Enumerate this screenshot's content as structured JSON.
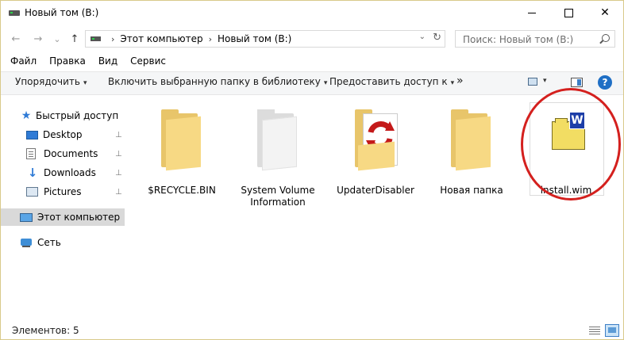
{
  "window": {
    "title": "Новый том (B:)",
    "controls": {
      "minimize": "minimize",
      "maximize": "maximize",
      "close": "✕"
    }
  },
  "nav": {
    "back": "←",
    "forward": "→",
    "recent": "⌄",
    "up": "↑",
    "breadcrumb": [
      "Этот компьютер",
      "Новый том (B:)"
    ],
    "breadcrumb_sep": "›",
    "dropdown": "⌄",
    "refresh": "↻",
    "search_placeholder": "Поиск: Новый том (B:)"
  },
  "menu": [
    "Файл",
    "Правка",
    "Вид",
    "Сервис"
  ],
  "commandbar": {
    "organize": "Упорядочить",
    "include_library": "Включить выбранную папку в библиотеку",
    "share": "Предоставить доступ к",
    "more": "»",
    "help": "?",
    "dropdown_arrow": "▾"
  },
  "sidebar": {
    "quick_access": "Быстрый доступ",
    "items": [
      {
        "label": "Desktop",
        "icon": "desktop-icon",
        "pinned": true
      },
      {
        "label": "Documents",
        "icon": "documents-icon",
        "pinned": true
      },
      {
        "label": "Downloads",
        "icon": "downloads-icon",
        "pinned": true
      },
      {
        "label": "Pictures",
        "icon": "pictures-icon",
        "pinned": true
      }
    ],
    "this_pc": "Этот компьютер",
    "network": "Сеть",
    "pin_glyph": "📌"
  },
  "files": [
    {
      "name": "$RECYCLE.BIN",
      "type": "folder"
    },
    {
      "name": "System Volume Information",
      "type": "system-folder"
    },
    {
      "name": "UpdaterDisabler",
      "type": "folder-with-app"
    },
    {
      "name": "Новая папка",
      "type": "folder"
    },
    {
      "name": "install.wim",
      "type": "wim-file",
      "badge": "W"
    }
  ],
  "colors": {
    "accent": "#1f6fc5",
    "annotation_ring": "#d4201e",
    "folder": "#f7d984"
  },
  "status": {
    "items_count": "Элементов: 5"
  }
}
